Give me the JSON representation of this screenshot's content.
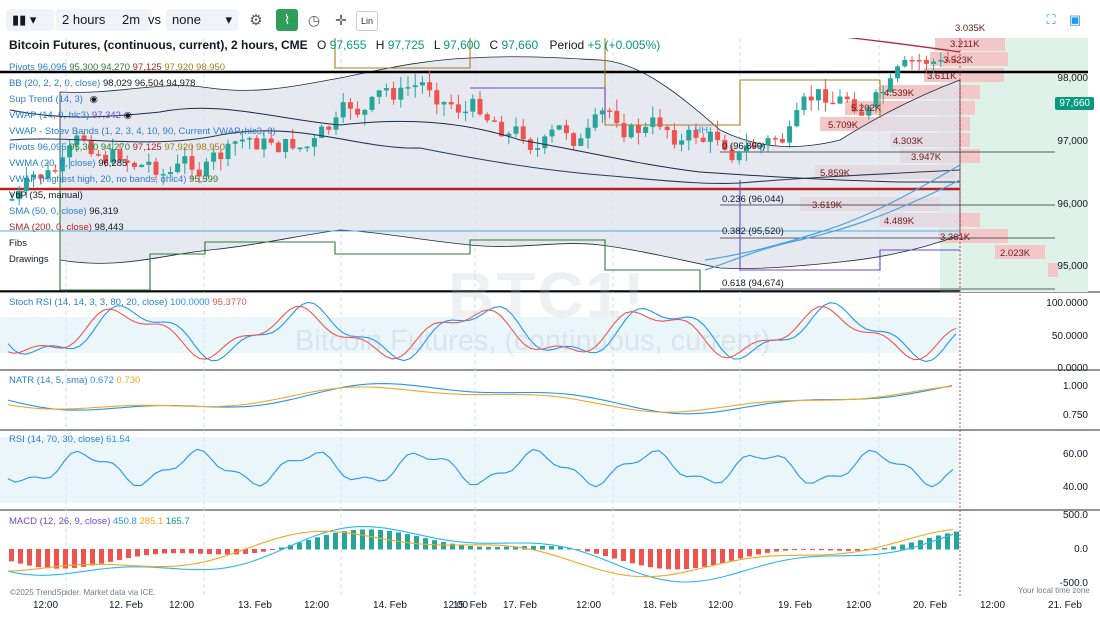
{
  "toolbar": {
    "interval": "2 hours",
    "range": "2m",
    "vs": "vs",
    "compare": "none",
    "lin": "Lin"
  },
  "symbol": {
    "title": "Bitcoin Futures, (continuous, current), 2 hours, CME",
    "o_label": "O",
    "o": "97,655",
    "h_label": "H",
    "h": "97,725",
    "l_label": "L",
    "l": "97,600",
    "c_label": "C",
    "c": "97,660",
    "period": "Period",
    "change": "+5 (+0.005%)",
    "watermark_ticker": "BTC1!",
    "watermark_name": "Bitcoin Futures, (continuous, current)"
  },
  "indicators": [
    {
      "name": "Pivots",
      "values": [
        "96,095",
        "95,300",
        "94,270",
        "97,125",
        "97,920",
        "98,950"
      ]
    },
    {
      "name": "BB (20, 2, 2, 0, close)",
      "values": [
        "98,029",
        "96,504",
        "94,978"
      ]
    },
    {
      "name": "Sup Trend (14, 3)",
      "values": []
    },
    {
      "name": "VWAP (14, 0, hlc3)",
      "values": [
        "97,342"
      ]
    },
    {
      "name": "VWAP - Stoev Bands (1, 2, 3, 4, 10, 90, Current VWAP, hlc3, 0)",
      "values": []
    },
    {
      "name": "Pivots",
      "values": [
        "96,095",
        "95,300",
        "94,270",
        "97,125",
        "97,920",
        "98,950"
      ]
    },
    {
      "name": "VWMA (20, 0, close)",
      "values": [
        "96,285"
      ]
    },
    {
      "name": "VWAP (Highest high, 20, no bands, ohlc4)",
      "values": [
        "95,599"
      ]
    },
    {
      "name": "VbP (35, manual)",
      "values": []
    },
    {
      "name": "SMA (50, 0, close)",
      "values": [
        "96,319"
      ]
    },
    {
      "name": "SMA (200, 0, close)",
      "values": [
        "98,443"
      ]
    },
    {
      "name": "Fibs",
      "values": []
    },
    {
      "name": "Drawings",
      "values": []
    }
  ],
  "price_axis": [
    "98,000",
    "97,000",
    "96,000",
    "95,000"
  ],
  "current_price": "97,660",
  "volume_profile_labels": [
    "3.035K",
    "3.211K",
    "3.523K",
    "3.611K",
    "4.539K",
    "5.202K",
    "5.709K",
    "4.303K",
    "3.947K",
    "5.859K",
    "3.619K",
    "4.489K",
    "3.361K",
    "2.023K"
  ],
  "fib_labels": [
    "0 (96,890)",
    "0.236 (96,044)",
    "0.382 (95,520)",
    "0.618 (94,674)",
    "HH"
  ],
  "stoch": {
    "label": "Stoch RSI (14, 14, 3, 3, 80, 20, close)",
    "v1": "100.0000",
    "v2": "95.3770",
    "axis": [
      "100.0000",
      "50.0000",
      "0.0000"
    ]
  },
  "natr": {
    "label": "NATR (14, 5, sma)",
    "v1": "0.672",
    "v2": "0.730",
    "axis": [
      "1.000",
      "0.750"
    ]
  },
  "rsi": {
    "label": "RSI (14, 70, 30, close)",
    "v1": "61.54",
    "axis": [
      "60.00",
      "40.00"
    ]
  },
  "macd": {
    "label": "MACD (12, 26, 9, close)",
    "v1": "450.8",
    "v2": "285.1",
    "v3": "165.7",
    "axis": [
      "500.0",
      "0.0",
      "-500.0"
    ]
  },
  "time_axis": [
    "12:00",
    "12. Feb",
    "12:00",
    "13. Feb",
    "12:00",
    "14. Feb",
    "12:00",
    "15. Feb",
    "17. Feb",
    "12:00",
    "18. Feb",
    "12:00",
    "19. Feb",
    "12:00",
    "20. Feb",
    "12:00",
    "21. Feb"
  ],
  "footer": {
    "copyright": "©2025 TrendSpider. Market data via ICE.",
    "timezone": "Your local time zone"
  },
  "colors": {
    "up": "#26a69a",
    "down": "#ef5350",
    "bb_fill": "#d8dde6",
    "accent": "#089981",
    "maroon": "#b22222"
  }
}
